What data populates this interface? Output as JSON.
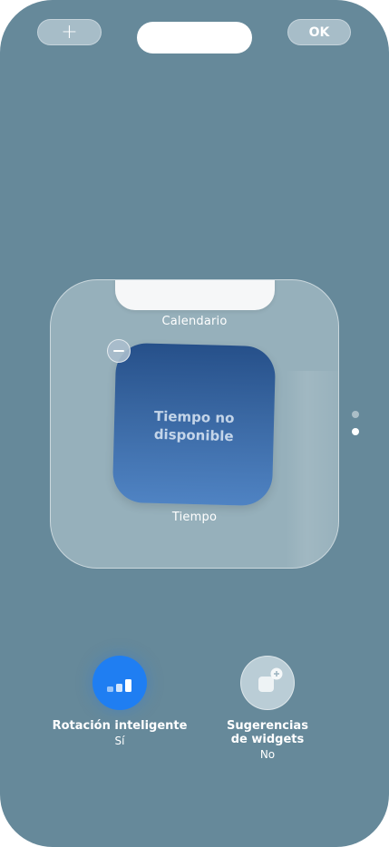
{
  "top_bar": {
    "add_label": "+",
    "ok_label": "OK"
  },
  "stack": {
    "calendar_label": "Calendario",
    "weather_text_line1": "Tiempo no",
    "weather_text_line2": "disponible",
    "weather_label": "Tiempo"
  },
  "options": {
    "smart_rotation": {
      "label": "Rotación inteligente",
      "value": "Sí",
      "icon": "signal-bars-icon"
    },
    "widget_suggestions": {
      "label_line1": "Sugerencias",
      "label_line2": "de widgets",
      "value": "No",
      "icon": "widget-plus-icon"
    }
  },
  "page_dots": {
    "count": 2,
    "active_index": 1
  },
  "colors": {
    "background": "#66899a",
    "accent": "#1f7ef2",
    "weather_top": "#26508a",
    "weather_bottom": "#4f83c3"
  }
}
